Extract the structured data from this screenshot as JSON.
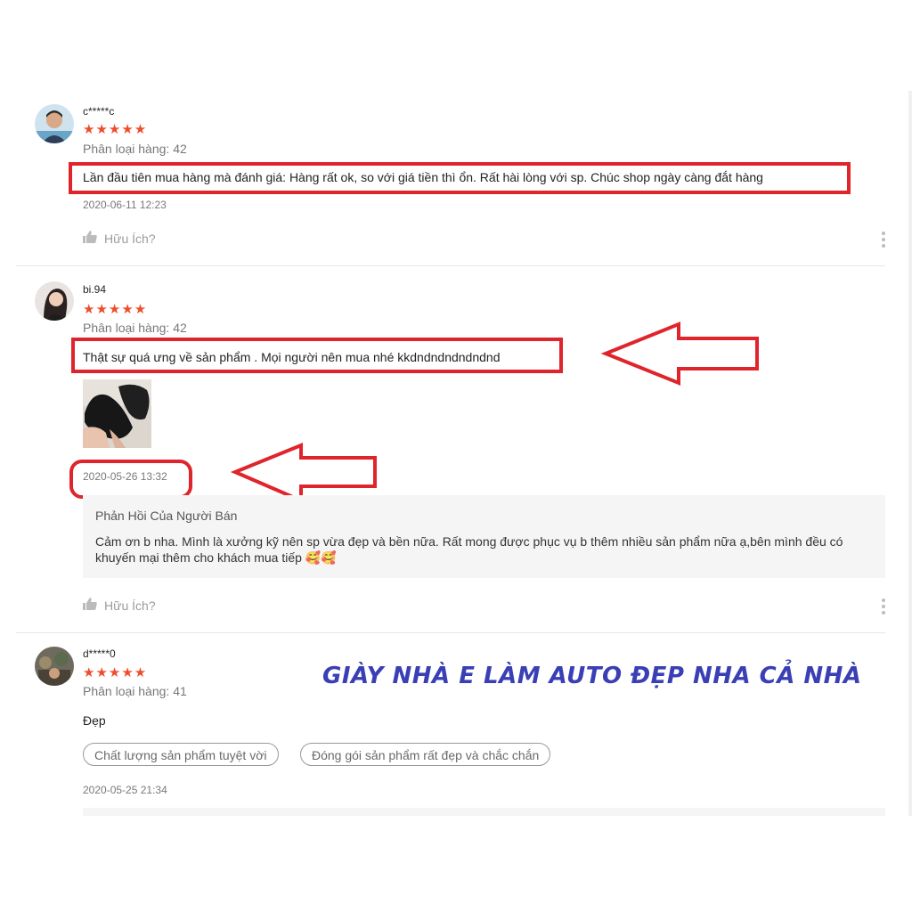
{
  "reviews": [
    {
      "username": "c*****c",
      "rating": 5,
      "stars": "★★★★★",
      "variation": "Phân loại hàng: 42",
      "comment": "Lần đầu tiên mua hàng mà đánh giá: Hàng rất ok, so với giá tiền thì ổn. Rất hài lòng với sp. Chúc shop ngày càng đắt hàng",
      "timestamp": "2020-06-11 12:23",
      "helpful_label": "Hữu Ích?"
    },
    {
      "username": "bi.94",
      "rating": 5,
      "stars": "★★★★★",
      "variation": "Phân loại hàng: 42",
      "comment": "Thật sự quá ưng về sản phẩm . Mọi người nên mua nhé kkdndndndndndnd",
      "timestamp": "2020-05-26 13:32",
      "seller_reply": {
        "title": "Phản Hồi Của Người Bán",
        "text": "Cảm ơn b nha. Mình là xưởng kỹ nên sp vừa đẹp và bền nữa. Rất mong được phục vụ b thêm nhiều sản phẩm nữa ạ,bên mình đều có khuyến mại thêm cho khách mua tiếp 🥰🥰"
      },
      "helpful_label": "Hữu Ích?"
    },
    {
      "username": "d*****0",
      "rating": 5,
      "stars": "★★★★★",
      "variation": "Phân loại hàng: 41",
      "comment": "Đẹp",
      "tags": [
        "Chất lượng sản phẩm tuyệt vời",
        "Đóng gói sản phẩm rất đẹp và chắc chắn"
      ],
      "timestamp": "2020-05-25 21:34"
    }
  ],
  "overlay_text": "GIÀY NHÀ E LÀM AUTO ĐẸP NHA CẢ NHÀ",
  "colors": {
    "star": "#ee4d2d",
    "annotation_red": "#e0242b",
    "overlay_blue": "#3a3fb5"
  }
}
